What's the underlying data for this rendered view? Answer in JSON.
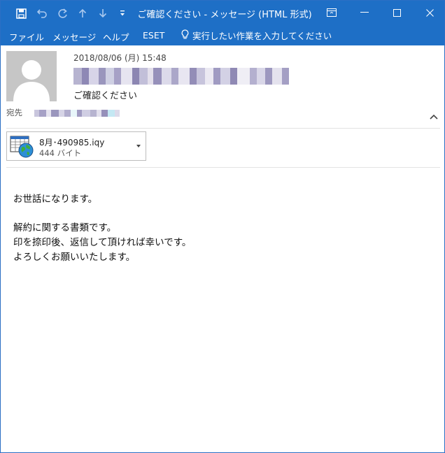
{
  "window": {
    "title": "ご確認ください  -  メッセージ (HTML 形式)"
  },
  "quick_access": {
    "icons": [
      "save-icon",
      "undo-icon",
      "redo-icon",
      "up-arrow-icon",
      "down-arrow-icon",
      "customize-icon"
    ]
  },
  "ribbon": {
    "tabs": [
      "ファイル",
      "メッセージ",
      "ヘルプ",
      "ESET"
    ],
    "tell_me": "実行したい作業を入力してください"
  },
  "message": {
    "datetime": "2018/08/06 (月) 15:48",
    "subject": "ご確認ください",
    "to_label": "宛先"
  },
  "attachment": {
    "name": "8月･490985.iqy",
    "size": "444 バイト"
  },
  "body": {
    "greeting": "お世話になります。",
    "line1": "解約に関する書類です。",
    "line2": "印を捺印後、返信して頂ければ幸いです。",
    "line3": "よろしくお願いいたします。"
  },
  "colors": {
    "titlebar": "#1e6fc6",
    "avatar_bg": "#c6c6c6"
  }
}
